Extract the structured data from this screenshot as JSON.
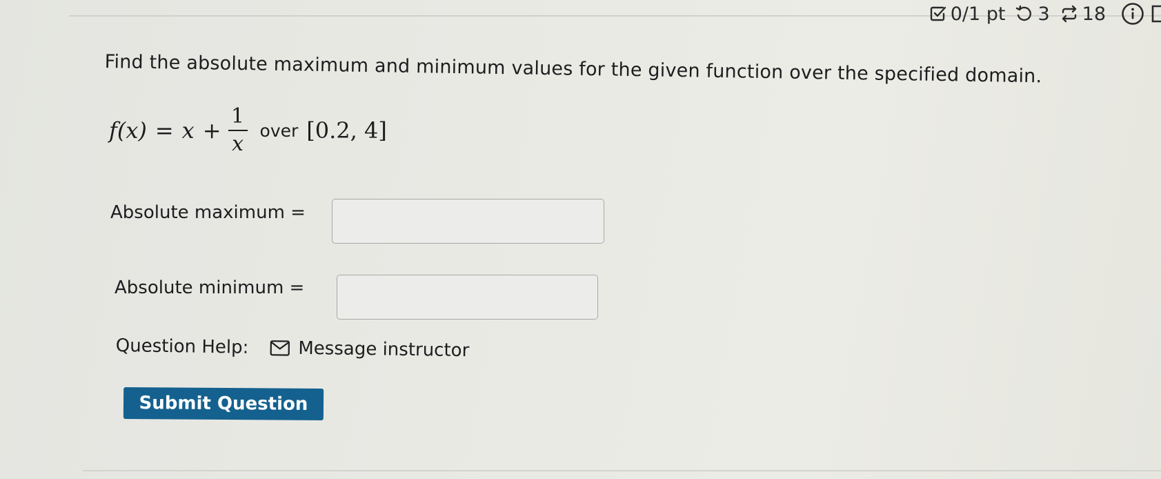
{
  "status": {
    "score": "0/1 pt",
    "retries": "3",
    "attempts": "18"
  },
  "question": {
    "prompt": "Find the absolute maximum and minimum values for the given function over the specified domain.",
    "formula": {
      "lhs": "f(x)",
      "equals": "=",
      "x": "x",
      "plus": "+",
      "numerator": "1",
      "denominator": "x",
      "over_word": "over",
      "interval": "[0.2, 4]"
    }
  },
  "answers": {
    "max_label": "Absolute maximum =",
    "max_value": "",
    "min_label": "Absolute minimum =",
    "min_value": ""
  },
  "help": {
    "label": "Question Help:",
    "message_link": "Message instructor"
  },
  "submit": {
    "label": "Submit Question"
  },
  "colors": {
    "submit_bg": "#14618f",
    "text": "#1d1d1f"
  }
}
